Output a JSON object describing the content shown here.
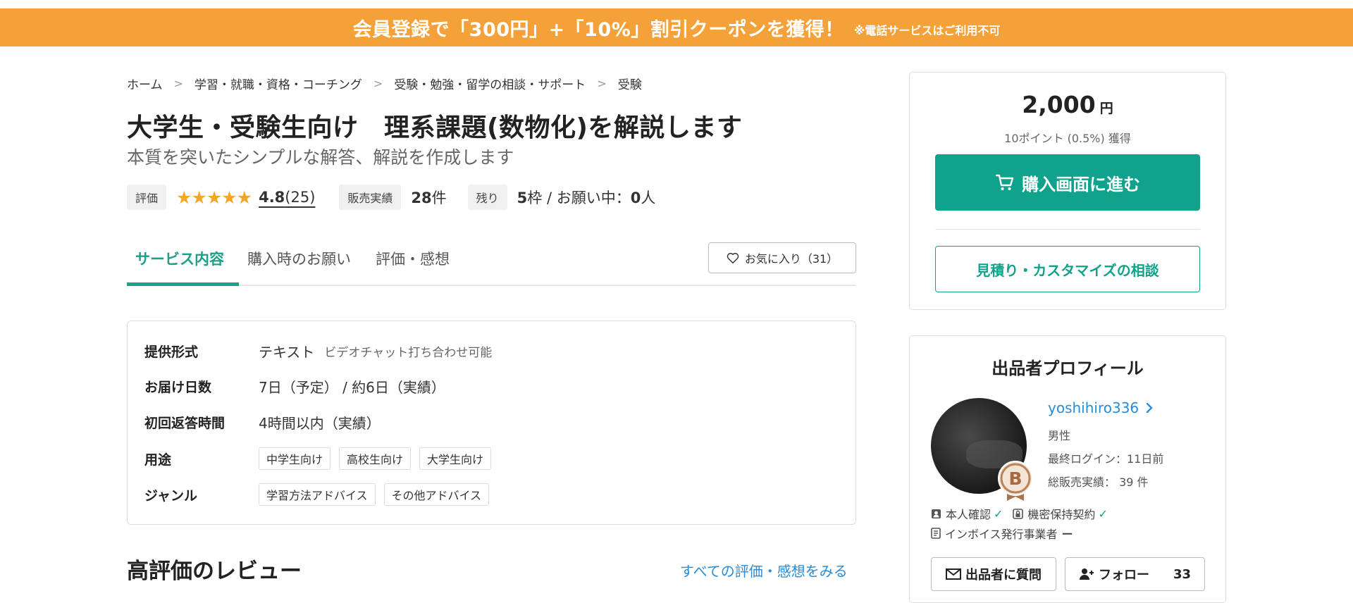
{
  "banner": {
    "main": "会員登録で「300円」+「10%」割引クーポンを獲得！",
    "note": "※電話サービスはご利用不可"
  },
  "breadcrumb": [
    "ホーム",
    "学習・就職・資格・コーチング",
    "受験・勉強・留学の相談・サポート",
    "受験"
  ],
  "service": {
    "title": "大学生・受験生向け　理系課題(数物化)を解説します",
    "subtitle": "本質を突いたシンプルな解答、解説を作成します"
  },
  "stats": {
    "rating_label": "評価",
    "stars": "★★★★★",
    "rating": "4.8",
    "rating_count": "(25)",
    "sales_label": "販売実績",
    "sales_value": "28",
    "sales_unit": "件",
    "remain_label": "残り",
    "remain_value": "5",
    "remain_text": "枠 / お願い中：",
    "requesting_value": "0",
    "requesting_unit": "人"
  },
  "tabs": [
    {
      "label": "サービス内容"
    },
    {
      "label": "購入時のお願い"
    },
    {
      "label": "評価・感想"
    }
  ],
  "favorite": {
    "label": "お気に入り（31）"
  },
  "details": {
    "format_label": "提供形式",
    "format_value": "テキスト",
    "format_sub": "ビデオチャット打ち合わせ可能",
    "delivery_label": "お届け日数",
    "delivery_value": "7日（予定） / 約6日（実績）",
    "response_label": "初回返答時間",
    "response_value": "4時間以内（実績）",
    "use_label": "用途",
    "use_chips": [
      "中学生向け",
      "高校生向け",
      "大学生向け"
    ],
    "genre_label": "ジャンル",
    "genre_chips": [
      "学習方法アドバイス",
      "その他アドバイス"
    ]
  },
  "reviews": {
    "heading": "高評価のレビュー",
    "link": "すべての評価・感想をみる"
  },
  "price_card": {
    "price": "2,000",
    "unit": "円",
    "points": "10ポイント (0.5%) 獲得",
    "buy": "購入画面に進む",
    "quote": "見積り・カスタマイズの相談"
  },
  "profile": {
    "heading": "出品者プロフィール",
    "username": "yoshihiro336",
    "gender": "男性",
    "last_login": "最終ログイン：11日前",
    "total_sales": "総販売実績： 39 件",
    "badge_letter": "B",
    "identity": "本人確認",
    "nda": "機密保持契約",
    "invoice": "インボイス発行事業者",
    "invoice_status": "ー",
    "ask": "出品者に質問",
    "follow": "フォロー",
    "followers": "33"
  },
  "colors": {
    "accent": "#11a28b",
    "banner": "#f5a13a",
    "link": "#2a8bd6",
    "star": "#f5a623"
  }
}
